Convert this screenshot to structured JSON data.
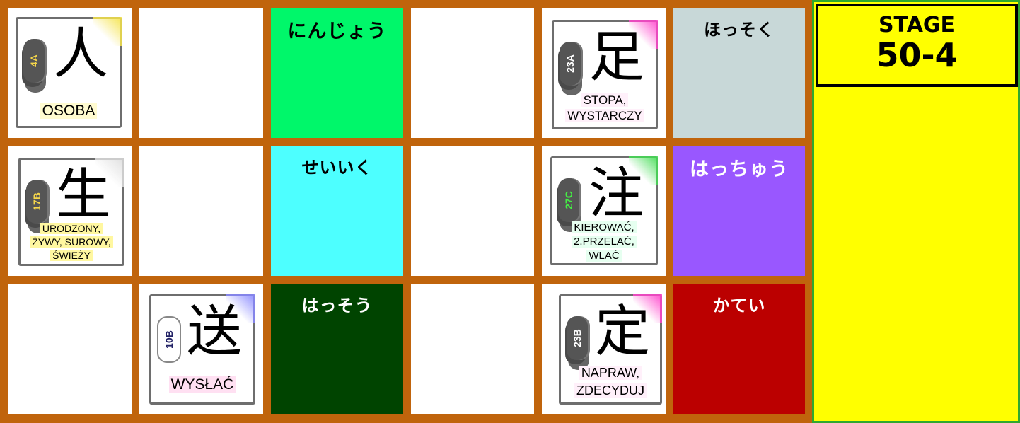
{
  "stage": {
    "label": "STAGE",
    "value": "50-4",
    "panel_color": "#ffff00"
  },
  "board": {
    "background_color": "#c0640c",
    "words": [
      {
        "text": "にんじょう",
        "bg": "#00f76a",
        "color": "#000000"
      },
      {
        "text": "ほっそく",
        "bg": "#c8d8d8",
        "color": "#000000"
      },
      {
        "text": "せいいく",
        "bg": "#4dffff",
        "color": "#000000"
      },
      {
        "text": "はっちゅう",
        "bg": "#9957ff",
        "color": "#ffffff"
      },
      {
        "text": "はっそう",
        "bg": "#004400",
        "color": "#ffffff"
      },
      {
        "text": "かてい",
        "bg": "#bb0000",
        "color": "#ffffff"
      }
    ],
    "kanji_cards": [
      {
        "kanji": "人",
        "code": "4A",
        "code_color": "#f5d64a",
        "glow": "#f5e34a",
        "meaning_lines": [
          "OSOBA"
        ],
        "meaning_highlight": "#fffbd0"
      },
      {
        "kanji": "足",
        "code": "23A",
        "code_color": "#ffffff",
        "glow": "#ff44cc",
        "meaning_lines": [
          "STOPA,",
          "WYSTARCZY"
        ],
        "meaning_highlight": "#fff0fa"
      },
      {
        "kanji": "生",
        "code": "17B",
        "code_color": "#f5d64a",
        "glow": "#dddddd",
        "meaning_lines": [
          "URODZONY,",
          "ŻYWY, SUROWY,",
          "ŚWIEŻY"
        ],
        "meaning_highlight": "#fff7a0"
      },
      {
        "kanji": "注",
        "code": "27C",
        "code_color": "#44ee44",
        "glow": "#44dd55",
        "meaning_lines": [
          "KIEROWAĆ,",
          "2.PRZELAĆ,",
          "WLAĆ"
        ],
        "meaning_highlight": "#e6fff0"
      },
      {
        "kanji": "送",
        "code": "10B",
        "code_color": "#222266",
        "glow": "#8888ff",
        "meaning_lines": [
          "WYSŁAĆ"
        ],
        "meaning_highlight": "#ffe0f2"
      },
      {
        "kanji": "定",
        "code": "23B",
        "code_color": "#ffffff",
        "glow": "#ff44cc",
        "meaning_lines": [
          "NAPRAW,",
          "ZDECYDUJ"
        ],
        "meaning_highlight": "#fff0fa"
      }
    ]
  }
}
